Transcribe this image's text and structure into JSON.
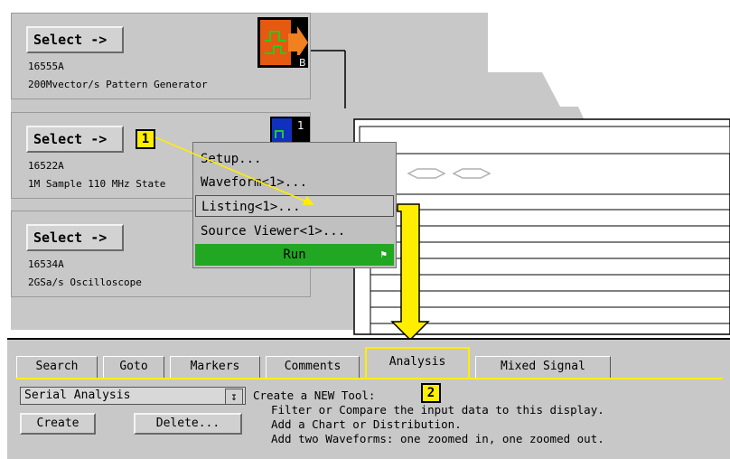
{
  "modules": [
    {
      "select_label": "Select ->",
      "model": "16555A",
      "description": "200Mvector/s Pattern Generator",
      "badge": "B"
    },
    {
      "select_label": "Select ->",
      "model": "16522A",
      "description": "1M Sample  110 MHz State",
      "badge": "1"
    },
    {
      "select_label": "Select ->",
      "model": "16534A",
      "description": "2GSa/s Oscilloscope"
    }
  ],
  "context_menu": {
    "items": [
      "Setup...",
      "Waveform<1>...",
      "Listing<1>...",
      "Source Viewer<1>...",
      "Run"
    ]
  },
  "callouts": [
    "1",
    "2"
  ],
  "tabs": [
    "Search",
    "Goto",
    "Markers",
    "Comments",
    "Analysis",
    "Mixed Signal"
  ],
  "analysis": {
    "dropdown_value": "Serial Analysis",
    "create_label": "Create",
    "delete_label": "Delete...",
    "help_lines": [
      "Create a NEW Tool:",
      "Filter or Compare the input data to this display.",
      "Add a Chart or Distribution.",
      "Add two Waveforms: one zoomed in, one zoomed out."
    ]
  },
  "colors": {
    "highlight": "#ffee00",
    "run_green": "#22a722",
    "panel_gray": "#c8c8c8"
  }
}
